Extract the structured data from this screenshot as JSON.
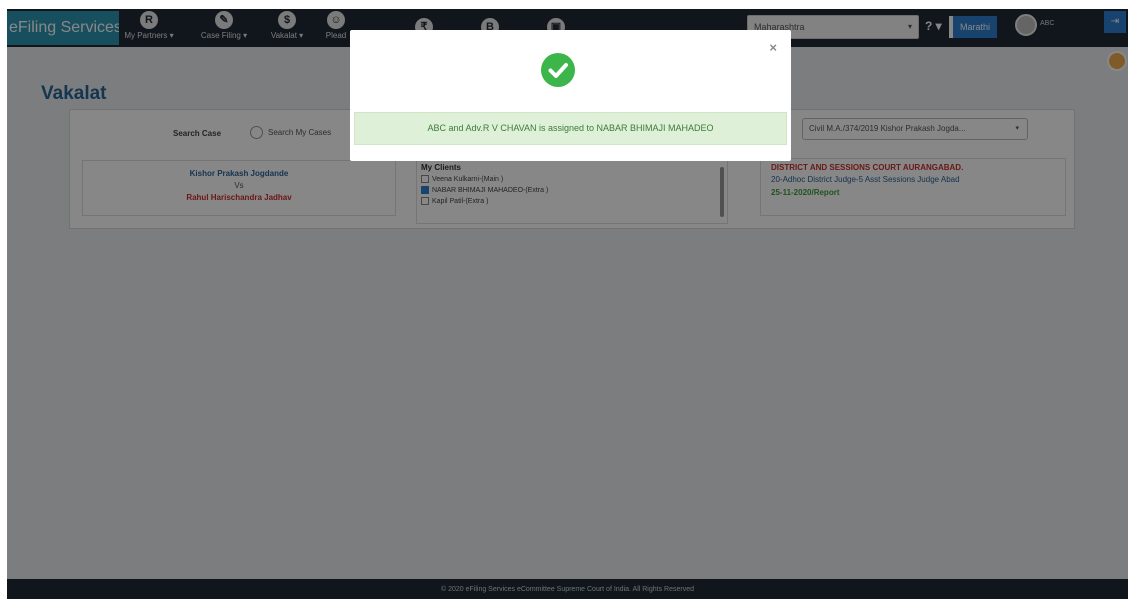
{
  "navbar": {
    "brand": "eFiling Services",
    "menus": [
      {
        "icon_letter": "R",
        "label": "My Partners ▾"
      },
      {
        "icon_letter": "✎",
        "label": "Case Filing ▾"
      },
      {
        "icon_letter": "$",
        "label": "Vakalat ▾"
      },
      {
        "icon_letter": "☺",
        "label": "Plead"
      }
    ],
    "extra_icons": [
      "₹",
      "B",
      "▣"
    ],
    "state": "Maharashtra",
    "help": "? ▾",
    "language": "Marathi",
    "user": "ABC",
    "logout_icon": "⇥"
  },
  "page": {
    "title": "Vakalat",
    "search_case_label": "Search Case",
    "search_my_cases": "Search My Cases",
    "case_select": "Civil M.A./374/2019 Kishor Prakash Jogda..."
  },
  "parties": {
    "petitioner": "Kishor Prakash Jogdande",
    "vs": "Vs",
    "respondent": "Rahul Harischandra Jadhav"
  },
  "clients": {
    "heading": "My Clients",
    "items": [
      {
        "name": "Veena Kulkarni-(Main )",
        "checked": false
      },
      {
        "name": "NABAR BHIMAJI MAHADEO-(Extra )",
        "checked": true
      },
      {
        "name": "Kapil Patil-(Extra )",
        "checked": false
      }
    ]
  },
  "court": {
    "name": "DISTRICT AND SESSIONS COURT AURANGABAD.",
    "judge": "20-Adhoc District Judge-5 Asst Sessions Judge Abad",
    "date": "25-11-2020/Report"
  },
  "footer": "© 2020 eFiling Services eCommittee Supreme Court of India. All Rights Reserved",
  "modal": {
    "close": "×",
    "message": "ABC and Adv.R V CHAVAN is assigned to NABAR BHIMAJI MAHADEO"
  },
  "colors": {
    "success": "#3cb54a",
    "brand": "#2f96b4",
    "navbar": "#1f2a36"
  }
}
